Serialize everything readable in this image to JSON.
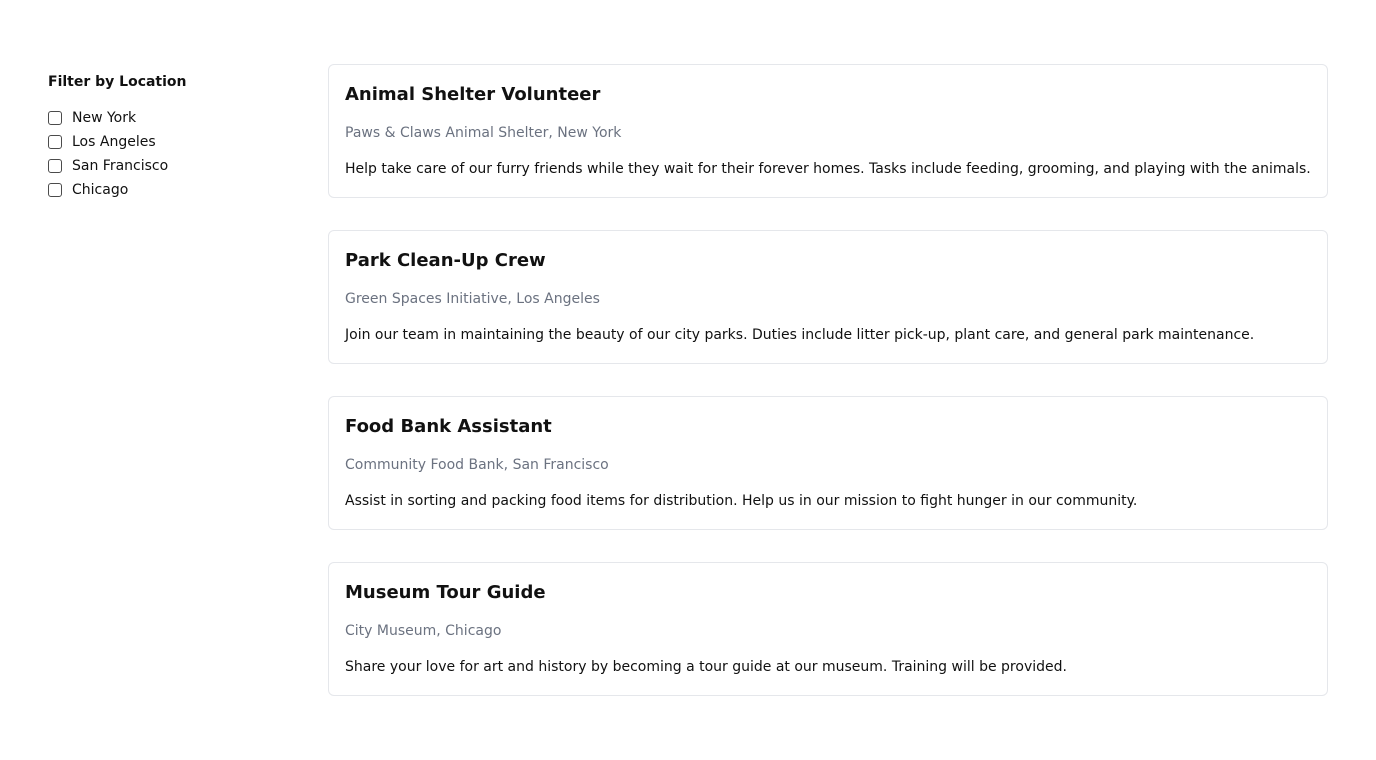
{
  "sidebar": {
    "title": "Filter by Location",
    "locations": [
      {
        "label": "New York",
        "checked": false
      },
      {
        "label": "Los Angeles",
        "checked": false
      },
      {
        "label": "San Francisco",
        "checked": false
      },
      {
        "label": "Chicago",
        "checked": false
      }
    ]
  },
  "listings": [
    {
      "title": "Animal Shelter Volunteer",
      "organization": "Paws & Claws Animal Shelter, New York",
      "description": "Help take care of our furry friends while they wait for their forever homes. Tasks include feeding, grooming, and playing with the animals."
    },
    {
      "title": "Park Clean-Up Crew",
      "organization": "Green Spaces Initiative, Los Angeles",
      "description": "Join our team in maintaining the beauty of our city parks. Duties include litter pick-up, plant care, and general park maintenance."
    },
    {
      "title": "Food Bank Assistant",
      "organization": "Community Food Bank, San Francisco",
      "description": "Assist in sorting and packing food items for distribution. Help us in our mission to fight hunger in our community."
    },
    {
      "title": "Museum Tour Guide",
      "organization": "City Museum, Chicago",
      "description": "Share your love for art and history by becoming a tour guide at our museum. Training will be provided."
    }
  ],
  "colors": {
    "text": "#111111",
    "muted": "#6b7280",
    "border": "#e5e7eb",
    "background": "#ffffff"
  }
}
